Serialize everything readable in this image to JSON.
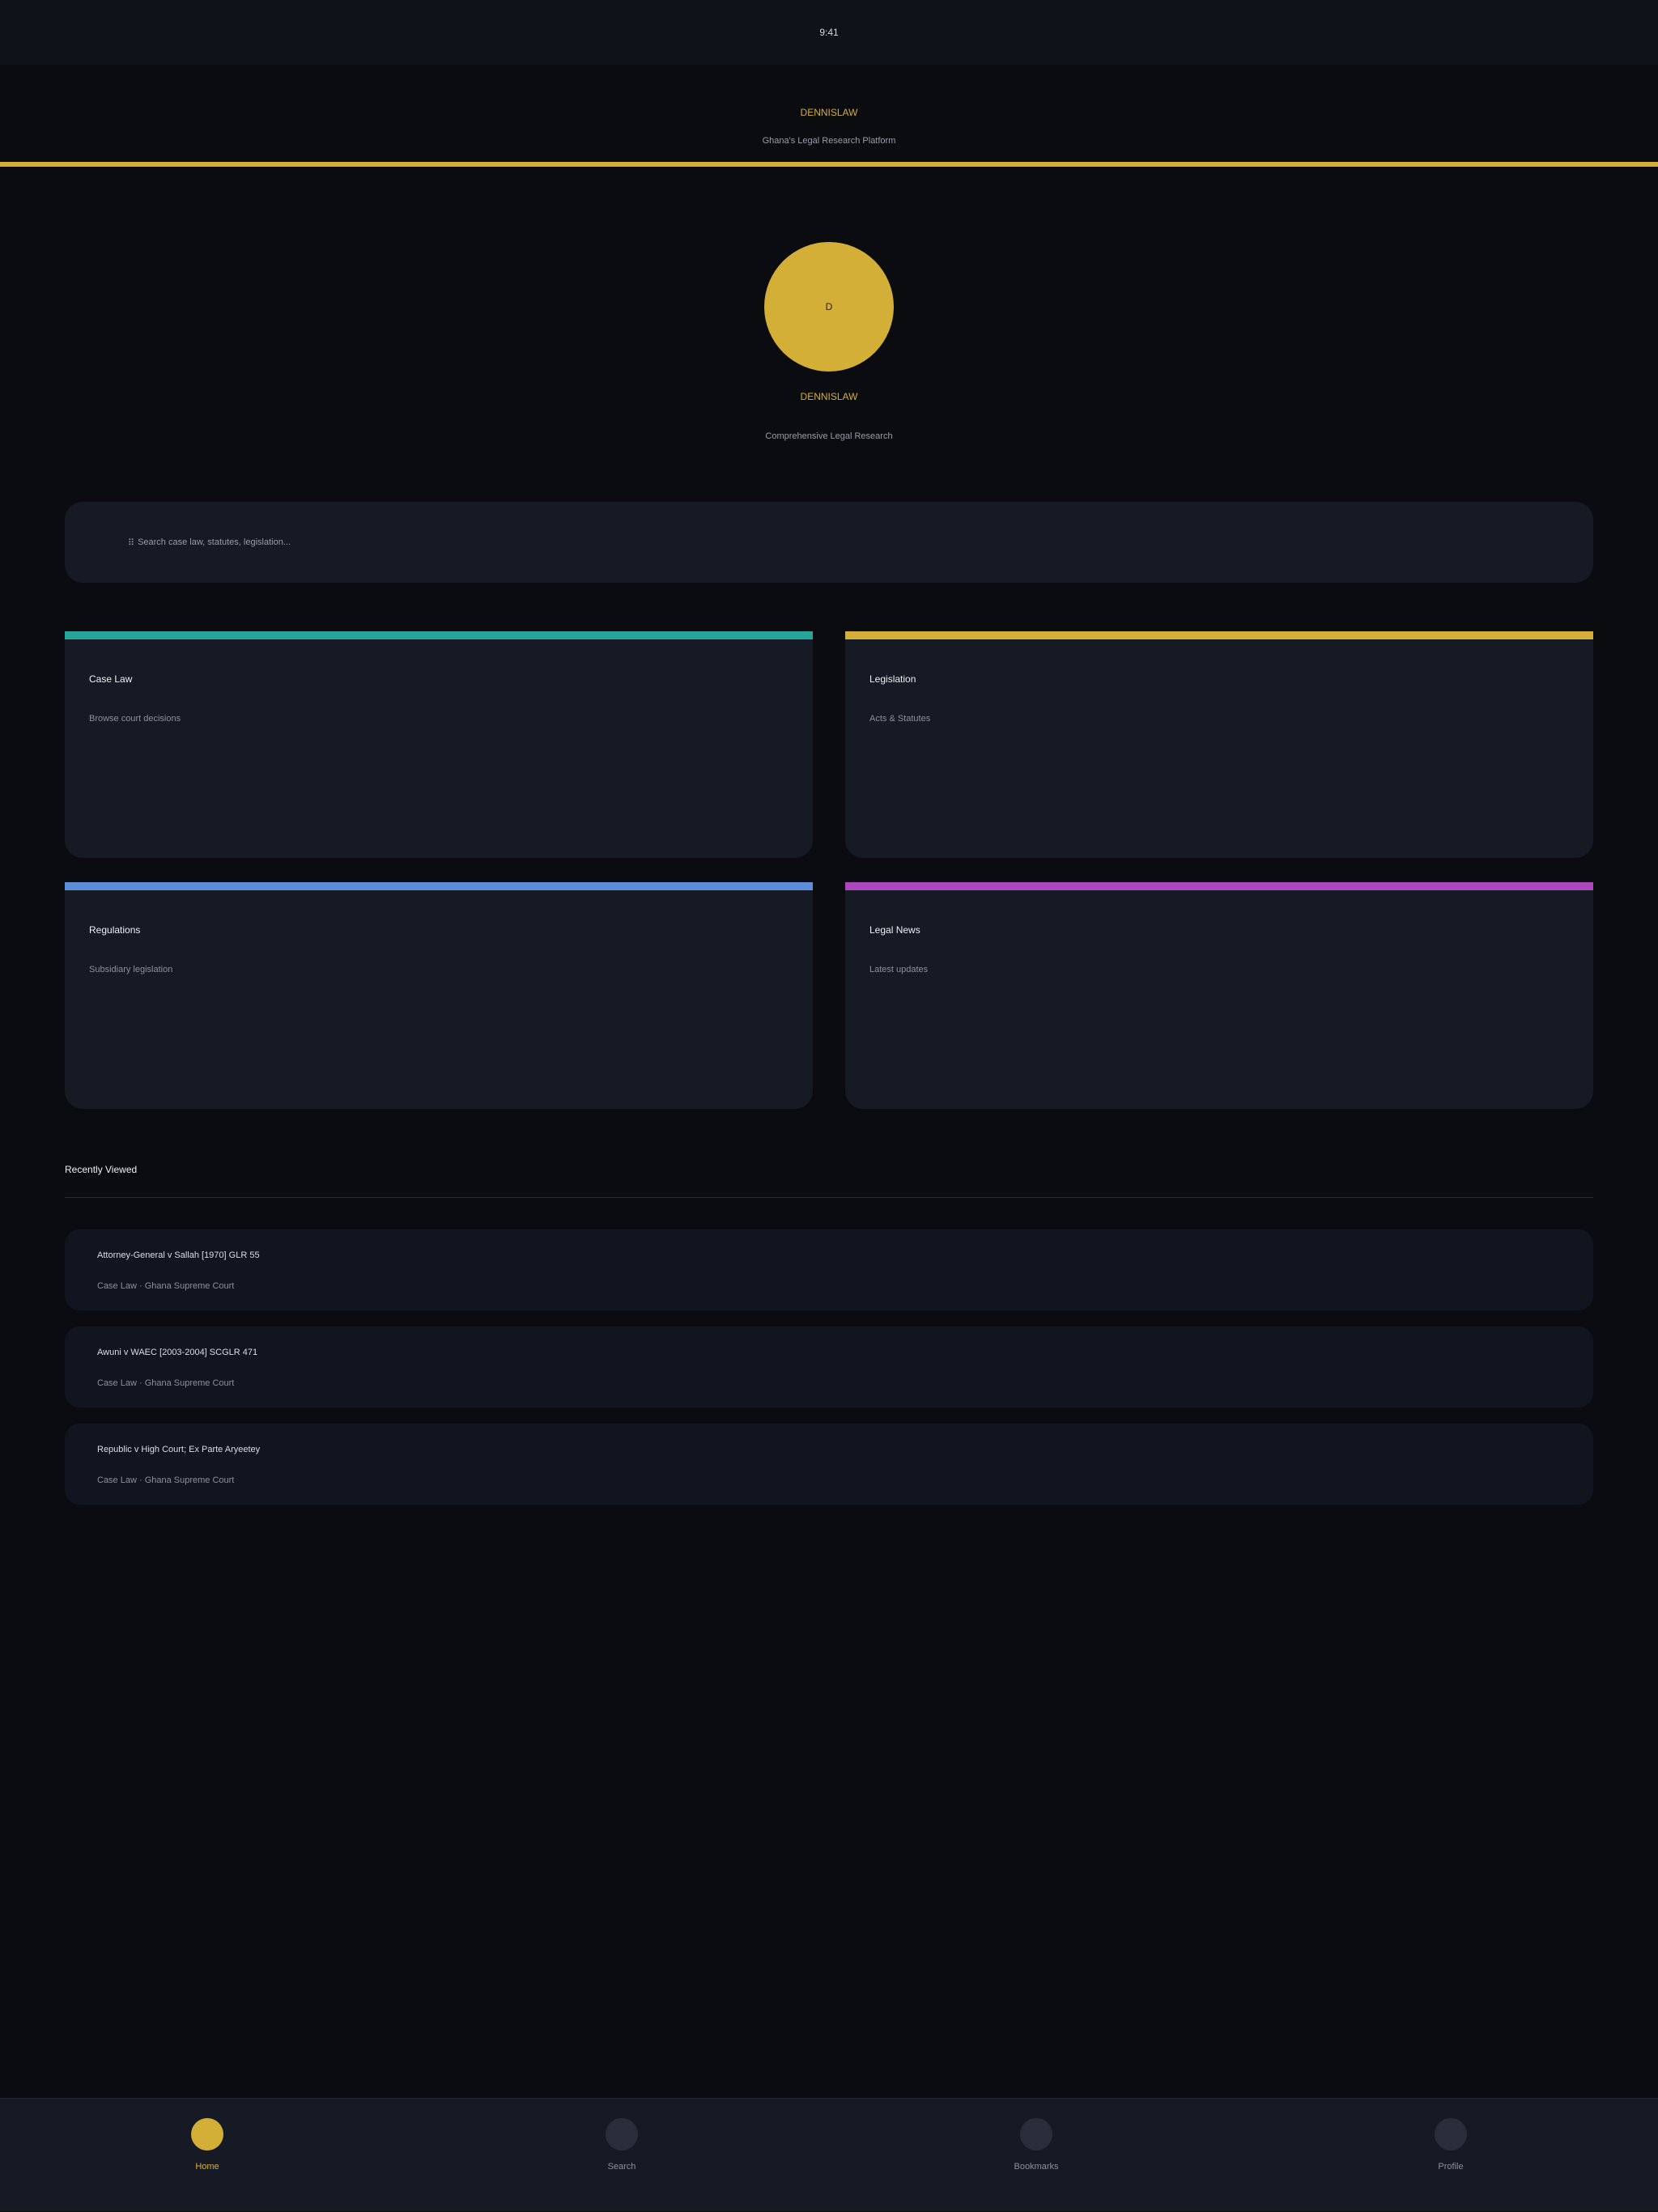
{
  "status_bar": {
    "time": "9:41"
  },
  "header": {
    "brand": "DENNISLAW",
    "subtitle": "Ghana's Legal Research Platform"
  },
  "hero": {
    "logo_letter": "D",
    "title": "DENNISLAW",
    "subtitle": "Comprehensive Legal Research"
  },
  "search": {
    "icon": "search-icon",
    "icon_glyph": "⠿",
    "placeholder": "Search case law, statutes, legislation..."
  },
  "categories": [
    {
      "title": "Case Law",
      "description": "Browse court decisions",
      "accent_color": "#26a69a"
    },
    {
      "title": "Legislation",
      "description": "Acts & Statutes",
      "accent_color": "#d4af37"
    },
    {
      "title": "Regulations",
      "description": "Subsidiary legislation",
      "accent_color": "#5b8fd9"
    },
    {
      "title": "Legal News",
      "description": "Latest updates",
      "accent_color": "#ab47bc"
    }
  ],
  "recent": {
    "title": "Recently Viewed",
    "items": [
      {
        "title": "Attorney-General v Sallah [1970] GLR 55",
        "meta": "Case Law · Ghana Supreme Court"
      },
      {
        "title": "Awuni v WAEC [2003-2004] SCGLR 471",
        "meta": "Case Law · Ghana Supreme Court"
      },
      {
        "title": "Republic v High Court; Ex Parte Aryeetey",
        "meta": "Case Law · Ghana Supreme Court"
      }
    ]
  },
  "tab_bar": {
    "tabs": [
      {
        "label": "Home",
        "active": true
      },
      {
        "label": "Search",
        "active": false
      },
      {
        "label": "Bookmarks",
        "active": false
      },
      {
        "label": "Profile",
        "active": false
      }
    ]
  },
  "colors": {
    "gold": "#d4af37",
    "background": "#0b0c10",
    "card": "#161a25"
  }
}
